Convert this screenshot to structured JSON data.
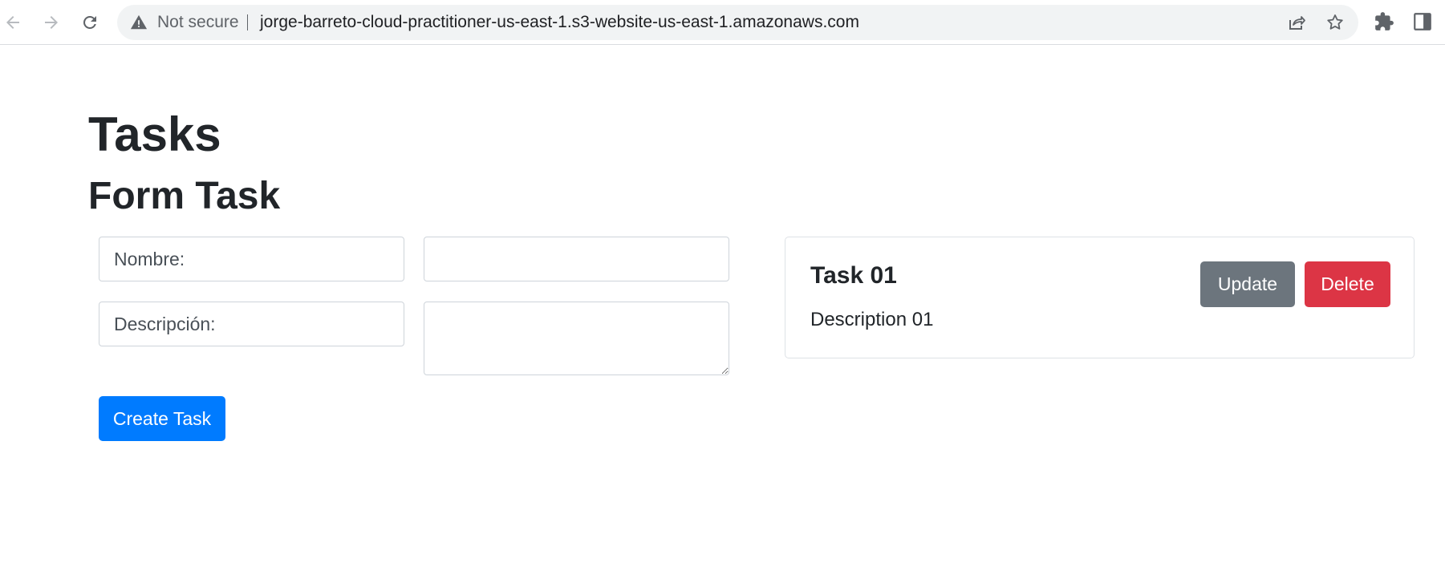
{
  "browser": {
    "security_label": "Not secure",
    "url": "jorge-barreto-cloud-practitioner-us-east-1.s3-website-us-east-1.amazonaws.com",
    "icons": [
      "back-icon",
      "forward-icon",
      "reload-icon",
      "warning-icon",
      "share-icon",
      "star-icon",
      "extensions-icon",
      "side-panel-icon"
    ]
  },
  "page": {
    "title": "Tasks",
    "form_heading": "Form Task",
    "form": {
      "name_label": "Nombre:",
      "name_value": "",
      "description_label": "Descripción:",
      "description_value": "",
      "submit_label": "Create Task"
    },
    "tasks": [
      {
        "title": "Task 01",
        "description": "Description 01",
        "update_label": "Update",
        "delete_label": "Delete"
      }
    ]
  },
  "colors": {
    "primary": "#007bff",
    "secondary": "#6c757d",
    "danger": "#dc3545",
    "text": "#212529"
  }
}
